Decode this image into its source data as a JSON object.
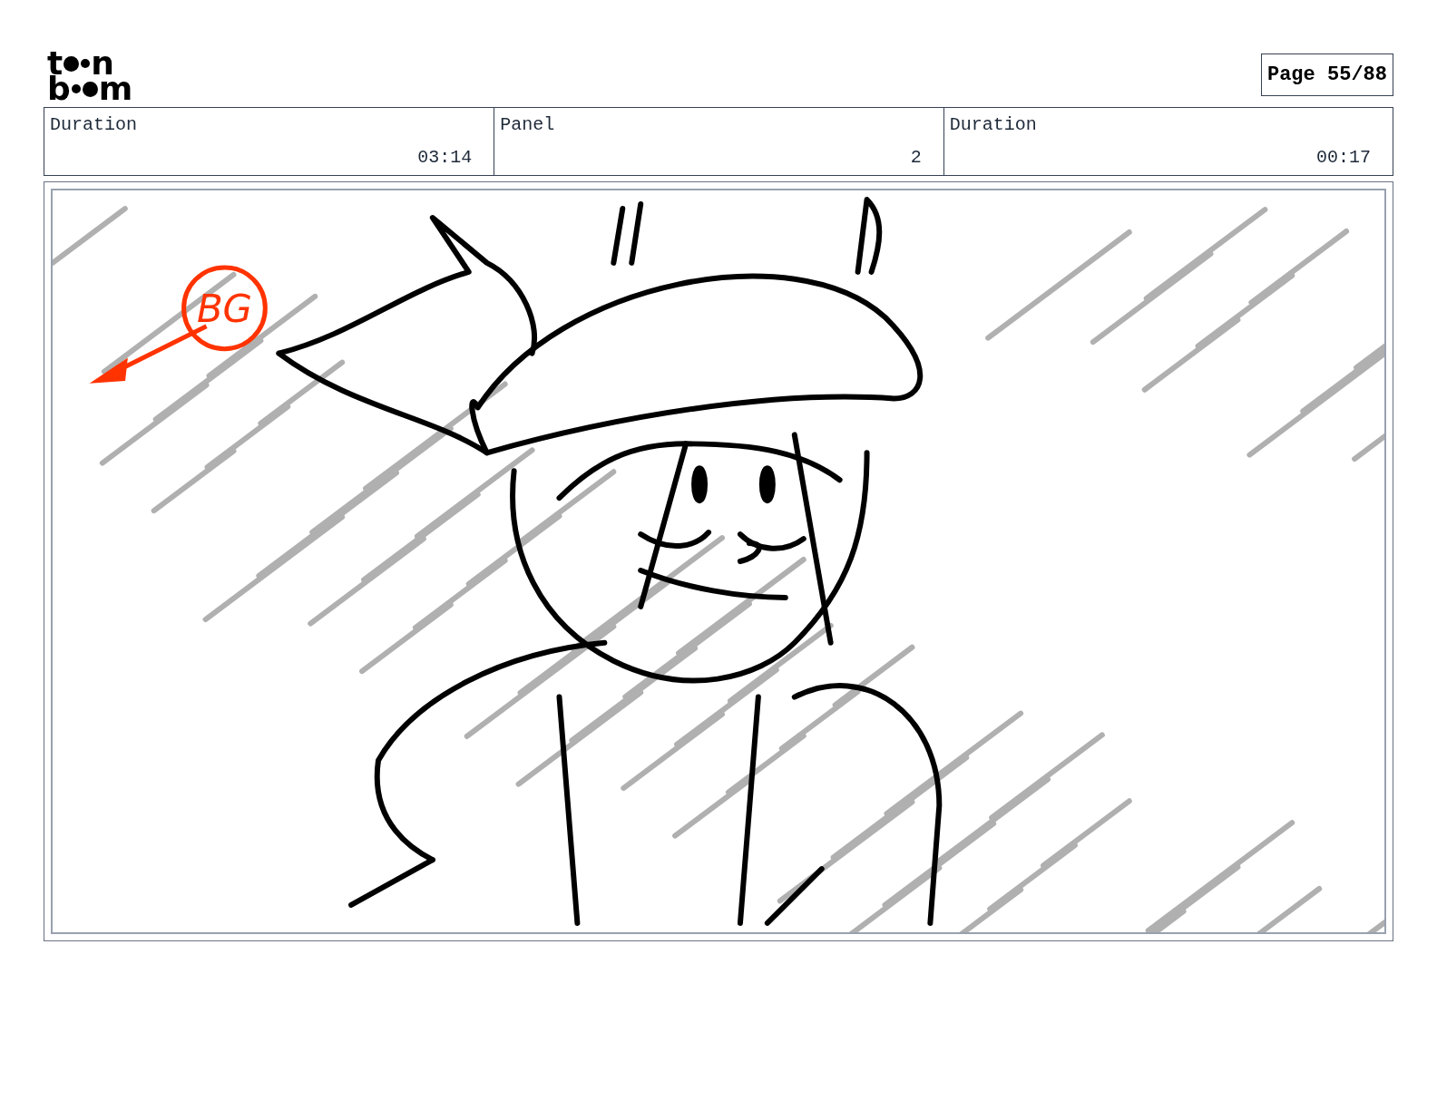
{
  "logo": {
    "top": [
      "t",
      "n"
    ],
    "bottom": [
      "b",
      "m"
    ]
  },
  "page_label": "Page 55/88",
  "header": [
    {
      "label": "Duration",
      "value": "03:14"
    },
    {
      "label": "Panel",
      "value": "2"
    },
    {
      "label": "Duration",
      "value": "00:17"
    }
  ],
  "panel": {
    "note": "BG"
  }
}
